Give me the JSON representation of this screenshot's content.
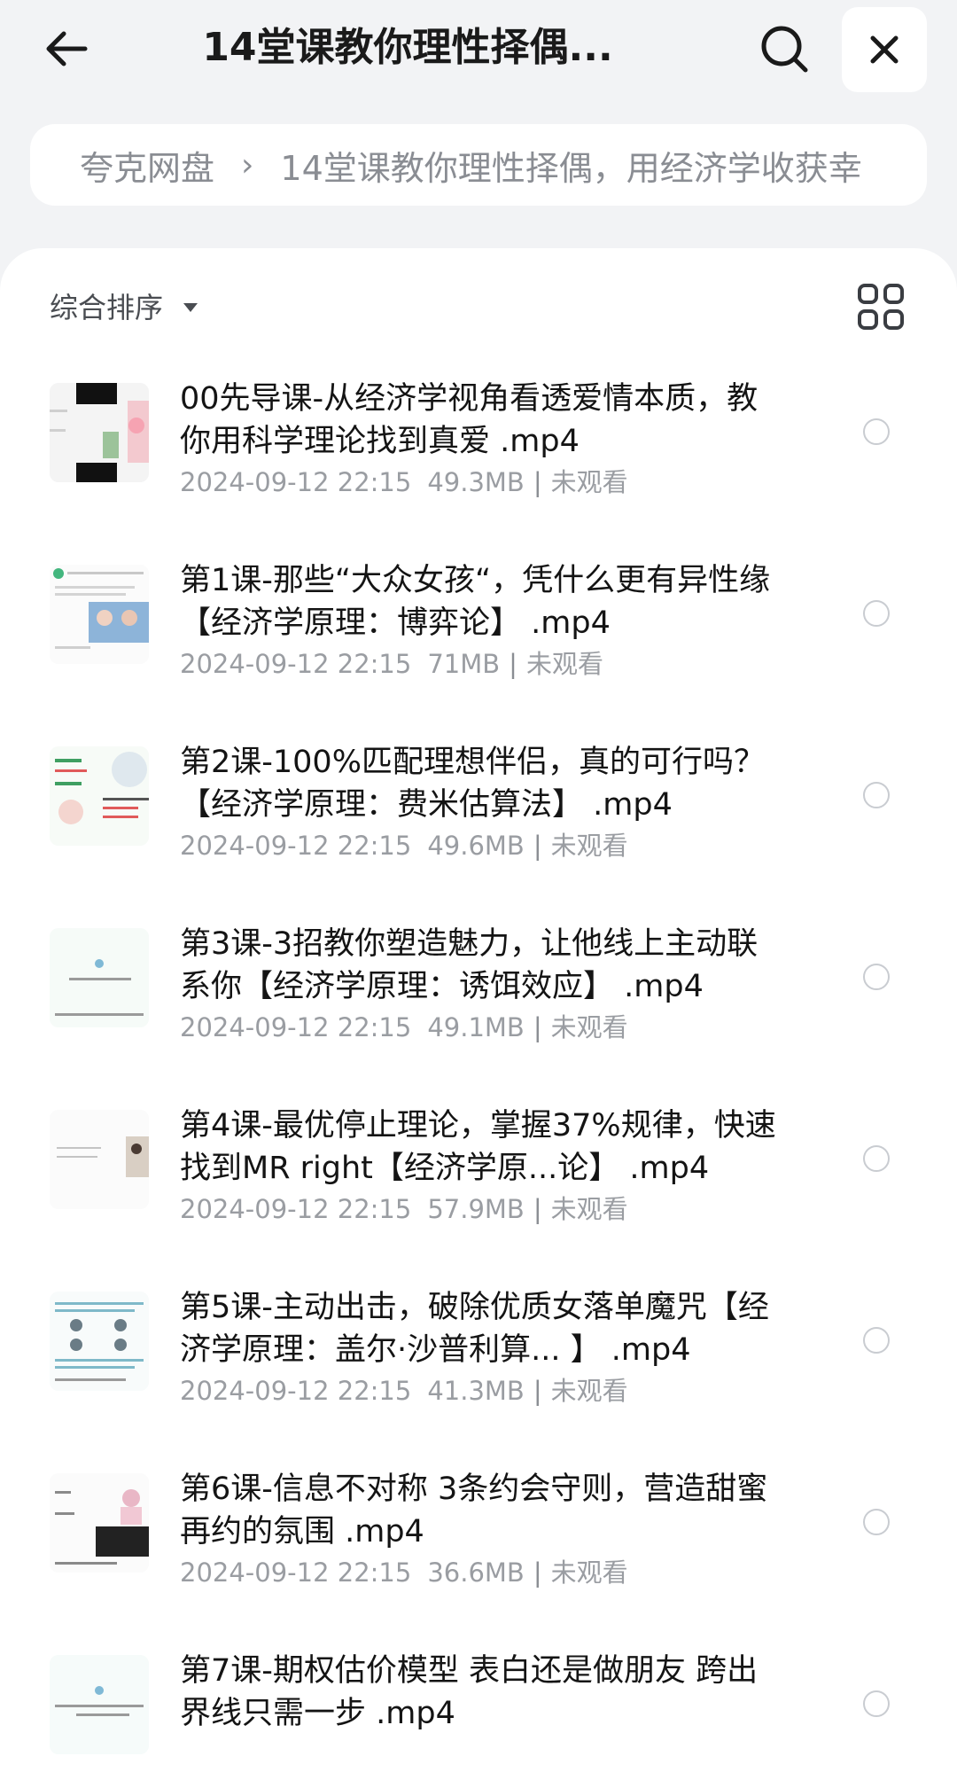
{
  "header": {
    "title": "14堂课教你理性择偶...",
    "back_icon": "arrow-left-icon",
    "search_icon": "search-icon",
    "close_icon": "close-icon"
  },
  "breadcrumb": {
    "root": "夸克网盘",
    "separator": "›",
    "current": "14堂课教你理性择偶，用经济学收获幸"
  },
  "toolbar": {
    "sort_label": "综合排序",
    "sort_icon": "caret-down-icon",
    "view_icon": "grid-view-icon"
  },
  "files": [
    {
      "name": "00先导课-从经济学视角看透爱情本质，教你用科学理论找到真爱 .mp4",
      "date": "2024-09-12 22:15",
      "size": "49.3MB",
      "status": "未观看"
    },
    {
      "name": "第1课-那些“大众女孩“，凭什么更有异性缘【经济学原理：博弈论】 .mp4",
      "date": "2024-09-12 22:15",
      "size": "71MB",
      "status": "未观看"
    },
    {
      "name": "第2课-100%匹配理想伴侣，真的可行吗？【经济学原理：费米估算法】 .mp4",
      "date": "2024-09-12 22:15",
      "size": "49.6MB",
      "status": "未观看"
    },
    {
      "name": "第3课-3招教你塑造魅力，让他线上主动联系你【经济学原理：诱饵效应】 .mp4",
      "date": "2024-09-12 22:15",
      "size": "49.1MB",
      "status": "未观看"
    },
    {
      "name": "第4课-最优停止理论，掌握37%规律，快速找到MR right【经济学原...论】 .mp4",
      "date": "2024-09-12 22:15",
      "size": "57.9MB",
      "status": "未观看"
    },
    {
      "name": "第5课-主动出击，破除优质女落单魔咒【经济学原理：盖尔·沙普利算... 】 .mp4",
      "date": "2024-09-12 22:15",
      "size": "41.3MB",
      "status": "未观看"
    },
    {
      "name": "第6课-信息不对称 3条约会守则，营造甜蜜再约的氛围 .mp4",
      "date": "2024-09-12 22:15",
      "size": "36.6MB",
      "status": "未观看"
    },
    {
      "name": "第7课-期权估价模型 表白还是做朋友 跨出界线只需一步 .mp4",
      "date": "",
      "size": "",
      "status": ""
    }
  ],
  "colors": {
    "background": "#f2f3f5",
    "panel": "#ffffff",
    "meta_text": "#9a9da2",
    "radio_border": "#c9ccd1"
  }
}
